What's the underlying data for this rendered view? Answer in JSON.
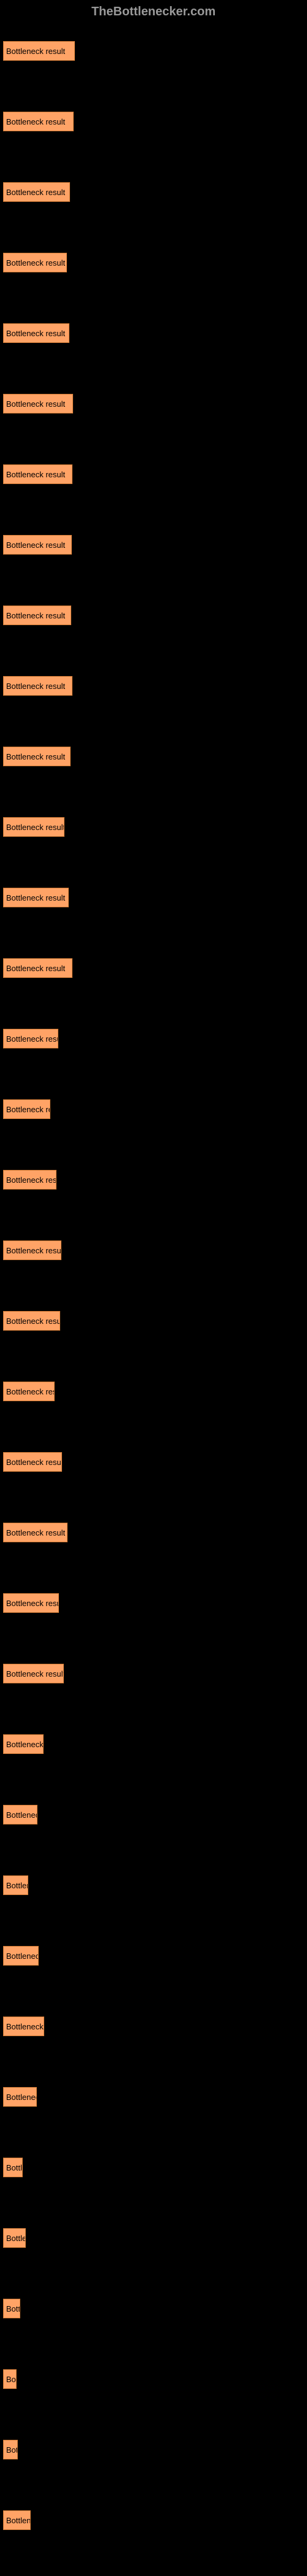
{
  "header": "TheBottlenecker.com",
  "label_text": "Bottleneck result",
  "chart_data": {
    "type": "bar",
    "title": "",
    "xlabel": "",
    "ylabel": "",
    "max_width": 117,
    "bars": [
      {
        "width": 117
      },
      {
        "width": 115
      },
      {
        "width": 109
      },
      {
        "width": 104
      },
      {
        "width": 108
      },
      {
        "width": 114
      },
      {
        "width": 113
      },
      {
        "width": 112
      },
      {
        "width": 111
      },
      {
        "width": 113
      },
      {
        "width": 110
      },
      {
        "width": 100
      },
      {
        "width": 107
      },
      {
        "width": 113
      },
      {
        "width": 90
      },
      {
        "width": 77
      },
      {
        "width": 87
      },
      {
        "width": 95
      },
      {
        "width": 93
      },
      {
        "width": 84
      },
      {
        "width": 96
      },
      {
        "width": 105
      },
      {
        "width": 91
      },
      {
        "width": 99
      },
      {
        "width": 66
      },
      {
        "width": 56
      },
      {
        "width": 41
      },
      {
        "width": 58
      },
      {
        "width": 67
      },
      {
        "width": 55
      },
      {
        "width": 32
      },
      {
        "width": 37
      },
      {
        "width": 28
      },
      {
        "width": 22
      },
      {
        "width": 24
      },
      {
        "width": 45
      }
    ]
  }
}
